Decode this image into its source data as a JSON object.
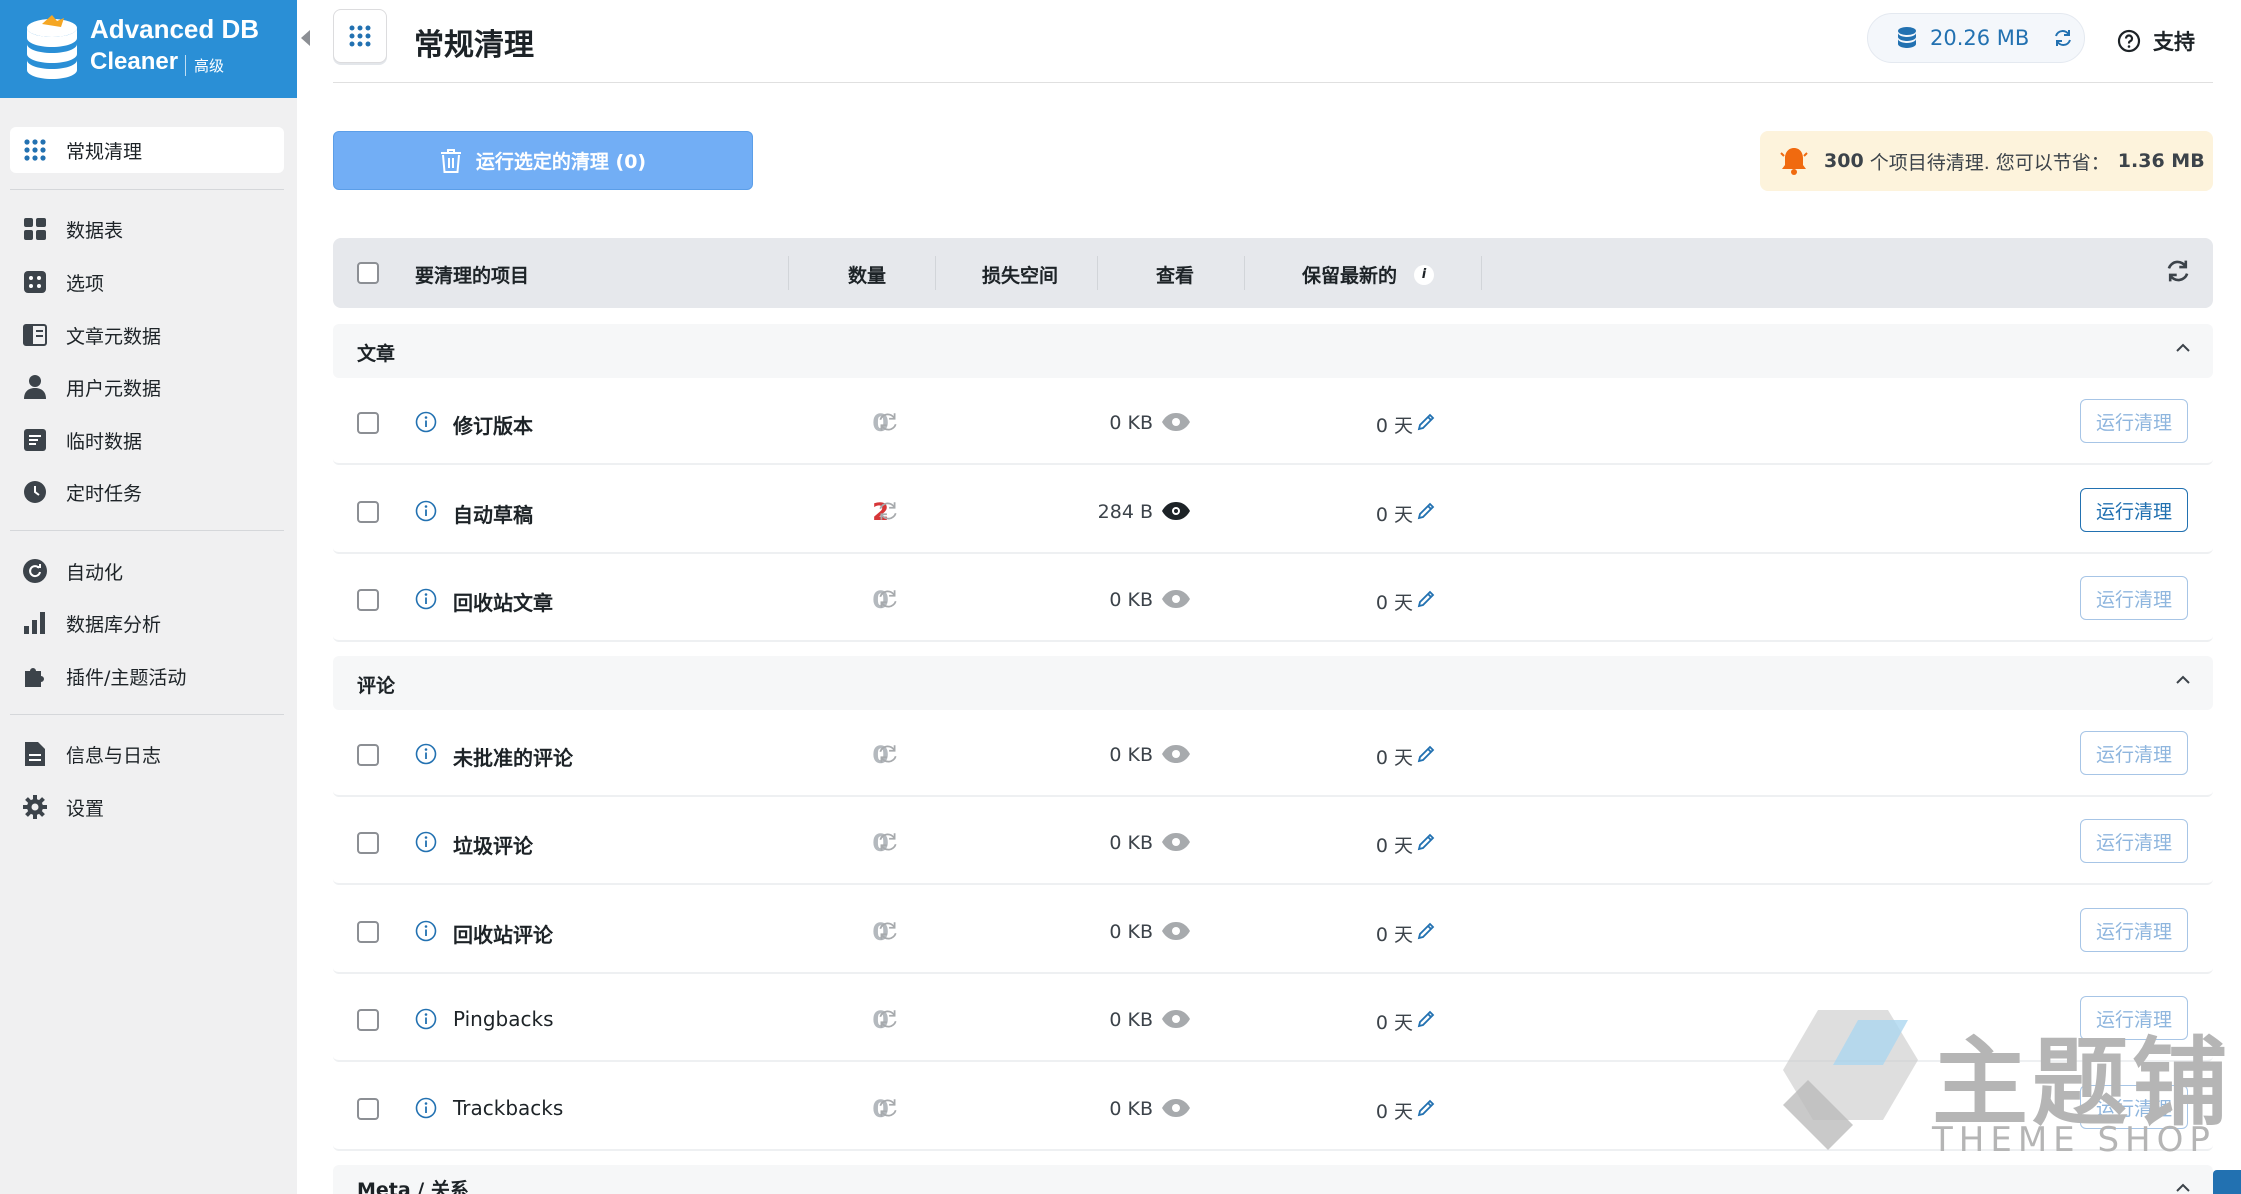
{
  "brand": {
    "line1": "Advanced DB",
    "line2": "Cleaner",
    "edition": "高级"
  },
  "sidebar": {
    "items": [
      {
        "label": "常规清理",
        "icon": "grid-icon"
      },
      {
        "label": "数据表",
        "icon": "table-icon"
      },
      {
        "label": "选项",
        "icon": "options-icon"
      },
      {
        "label": "文章元数据",
        "icon": "post-meta-icon"
      },
      {
        "label": "用户元数据",
        "icon": "user-icon"
      },
      {
        "label": "临时数据",
        "icon": "transient-icon"
      },
      {
        "label": "定时任务",
        "icon": "clock-icon"
      },
      {
        "label": "自动化",
        "icon": "automation-icon"
      },
      {
        "label": "数据库分析",
        "icon": "bar-chart-icon"
      },
      {
        "label": "插件/主题活动",
        "icon": "puzzle-icon"
      },
      {
        "label": "信息与日志",
        "icon": "document-icon"
      },
      {
        "label": "设置",
        "icon": "gear-icon"
      }
    ]
  },
  "header": {
    "title": "常规清理",
    "db_size": "20.26 MB",
    "support": "支持"
  },
  "actions": {
    "run_selected": "运行选定的清理 (0)"
  },
  "notice": {
    "count": "300",
    "text": " 个项目待清理. 您可以节省：",
    "saving": "1.36 MB"
  },
  "table": {
    "headers": {
      "item": "要清理的项目",
      "count": "数量",
      "space": "损失空间",
      "view": "查看",
      "keep": "保留最新的"
    },
    "sections": [
      {
        "label": "文章",
        "rows": [
          {
            "name": "修订版本",
            "count": "0",
            "space": "0 KB",
            "days": "0 天",
            "run": "运行清理"
          },
          {
            "name": "自动草稿",
            "count": "2",
            "space": "284 B",
            "days": "0 天",
            "run": "运行清理"
          },
          {
            "name": "回收站文章",
            "count": "0",
            "space": "0 KB",
            "days": "0 天",
            "run": "运行清理"
          }
        ]
      },
      {
        "label": "评论",
        "rows": [
          {
            "name": "未批准的评论",
            "count": "0",
            "space": "0 KB",
            "days": "0 天",
            "run": "运行清理"
          },
          {
            "name": "垃圾评论",
            "count": "0",
            "space": "0 KB",
            "days": "0 天",
            "run": "运行清理"
          },
          {
            "name": "回收站评论",
            "count": "0",
            "space": "0 KB",
            "days": "0 天",
            "run": "运行清理"
          },
          {
            "name": "Pingbacks",
            "count": "0",
            "space": "0 KB",
            "days": "0 天",
            "run": "运行清理"
          },
          {
            "name": "Trackbacks",
            "count": "0",
            "space": "0 KB",
            "days": "0 天",
            "run": "运行清理"
          }
        ]
      },
      {
        "label": "Meta / 关系",
        "rows": []
      }
    ]
  },
  "watermark": {
    "text": "主题铺",
    "sub": "THEME SHOP"
  },
  "colors": {
    "brand": "#2a8fd6",
    "accent": "#2271b1",
    "danger": "#d63638",
    "notice_bg": "#fdf3dc",
    "bell": "#f06a0f"
  }
}
